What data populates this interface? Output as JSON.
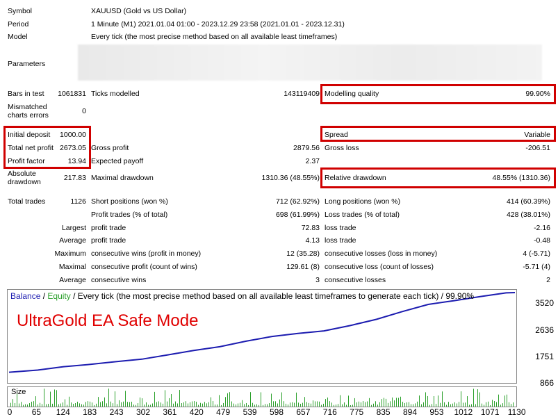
{
  "report": {
    "symbol_label": "Symbol",
    "symbol_value": "XAUUSD (Gold vs US Dollar)",
    "period_label": "Period",
    "period_value": "1 Minute (M1) 2021.01.04 01:00 - 2023.12.29 23:58 (2021.01.01 - 2023.12.31)",
    "model_label": "Model",
    "model_value": "Every tick (the most precise method based on all available least timeframes)",
    "parameters_label": "Parameters",
    "bars_label": "Bars in test",
    "bars_value": "1061831",
    "ticks_label": "Ticks modelled",
    "ticks_value": "143119409",
    "mq_label": "Modelling quality",
    "mq_value": "99.90%",
    "mismatched_label_1": "Mismatched",
    "mismatched_label_2": "charts errors",
    "mismatched_value": "0",
    "deposit_label": "Initial deposit",
    "deposit_value": "1000.00",
    "spread_label": "Spread",
    "spread_value": "Variable",
    "netprofit_label": "Total net profit",
    "netprofit_value": "2673.05",
    "grossprofit_label": "Gross profit",
    "grossprofit_value": "2879.56",
    "grossloss_label": "Gross loss",
    "grossloss_value": "-206.51",
    "pf_label": "Profit factor",
    "pf_value": "13.94",
    "ep_label": "Expected payoff",
    "ep_value": "2.37",
    "absdd_label_1": "Absolute",
    "absdd_label_2": "drawdown",
    "absdd_value": "217.83",
    "maxdd_label": "Maximal drawdown",
    "maxdd_value": "1310.36 (48.55%)",
    "reldd_label": "Relative drawdown",
    "reldd_value": "48.55% (1310.36)",
    "trades_label": "Total trades",
    "trades_value": "1126",
    "short_label": "Short positions (won %)",
    "short_value": "712 (62.92%)",
    "long_label": "Long positions (won %)",
    "long_value": "414 (60.39%)",
    "ptrades_label": "Profit trades (% of total)",
    "ptrades_value": "698 (61.99%)",
    "ltrades_label": "Loss trades (% of total)",
    "ltrades_value": "428 (38.01%)",
    "largest_label": "Largest",
    "largest_profit_label": "profit trade",
    "largest_profit_value": "72.83",
    "largest_loss_label": "loss trade",
    "largest_loss_value": "-2.16",
    "average_label": "Average",
    "avg_profit_label": "profit trade",
    "avg_profit_value": "4.13",
    "avg_loss_label": "loss trade",
    "avg_loss_value": "-0.48",
    "maximum_label": "Maximum",
    "max_wins_label": "consecutive wins (profit in money)",
    "max_wins_value": "12 (35.28)",
    "max_losses_label": "consecutive losses (loss in money)",
    "max_losses_value": "4 (-5.71)",
    "maximal_label": "Maximal",
    "maximal_profit_label": "consecutive profit (count of wins)",
    "maximal_profit_value": "129.61 (8)",
    "maximal_loss_label": "consecutive loss (count of losses)",
    "maximal_loss_value": "-5.71 (4)",
    "average2_label": "Average",
    "avg_wins_label": "consecutive wins",
    "avg_wins_value": "3",
    "avg_losses_label": "consecutive losses",
    "avg_losses_value": "2"
  },
  "chart": {
    "legend_balance": "Balance",
    "legend_sep": " / ",
    "legend_equity": "Equity",
    "legend_rest": " / Every tick (the most precise method based on all available least timeframes to generate each tick) / 99.90%",
    "watermark": "UltraGold EA Safe Mode",
    "size_label": "Size",
    "balance_color": "#1c1cb0",
    "equity_color": "#2aa02a",
    "y_ticks": [
      "3520",
      "2636",
      "1751",
      "866"
    ],
    "x_ticks": [
      "0",
      "65",
      "124",
      "183",
      "243",
      "302",
      "361",
      "420",
      "479",
      "539",
      "598",
      "657",
      "716",
      "775",
      "835",
      "894",
      "953",
      "1012",
      "1071",
      "1130"
    ]
  },
  "chart_data": {
    "type": "line",
    "series": [
      {
        "name": "Balance",
        "x": [
          0,
          65,
          124,
          183,
          243,
          302,
          361,
          420,
          479,
          539,
          598,
          657,
          716,
          775,
          835,
          894,
          953,
          1012,
          1071,
          1130,
          1150
        ],
        "values": [
          1000,
          1070,
          1180,
          1250,
          1340,
          1420,
          1560,
          1700,
          1820,
          2000,
          2150,
          2250,
          2330,
          2500,
          2700,
          2950,
          3180,
          3300,
          3430,
          3550,
          3560
        ]
      }
    ],
    "ylim": [
      866,
      3560
    ],
    "xlim": [
      0,
      1150
    ]
  }
}
